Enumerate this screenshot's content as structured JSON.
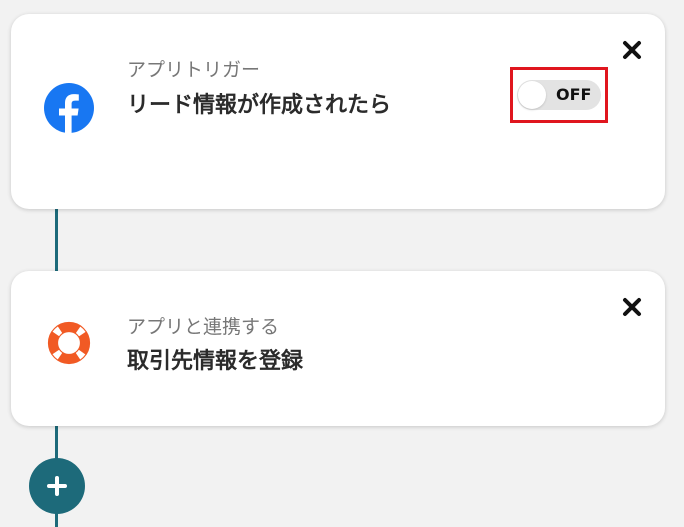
{
  "flow": {
    "steps": [
      {
        "app_icon": "facebook-icon",
        "subtitle": "アプリトリガー",
        "title": "リード情報が作成されたら",
        "toggle_label": "OFF",
        "close_icon": "close-icon"
      },
      {
        "app_icon": "lifebuoy-icon",
        "subtitle": "アプリと連携する",
        "title": "取引先情報を登録",
        "close_icon": "close-icon"
      }
    ],
    "add_icon": "plus-icon"
  },
  "colors": {
    "accent": "#1d6a7a",
    "facebook": "#1877f2",
    "lifebuoy": "#f15a24",
    "highlight": "#e0161e",
    "toggle_off": "#e3e3e3"
  }
}
